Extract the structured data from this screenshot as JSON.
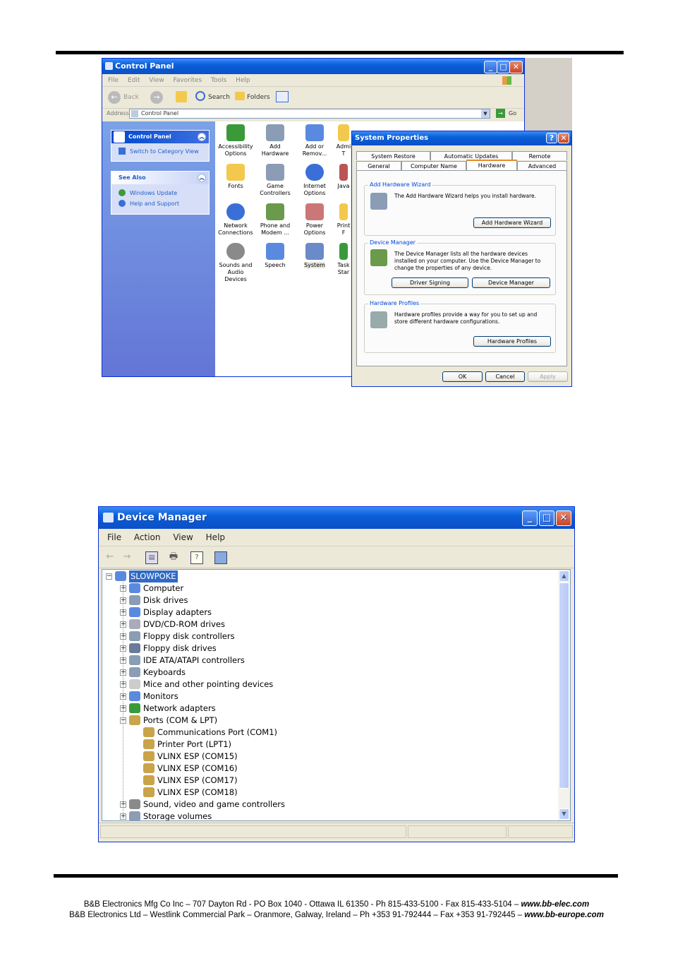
{
  "control_panel": {
    "title": "Control Panel",
    "menu": [
      "File",
      "Edit",
      "View",
      "Favorites",
      "Tools",
      "Help"
    ],
    "toolbar": {
      "back": "Back",
      "search": "Search",
      "folders": "Folders"
    },
    "address_label": "Address",
    "address_value": "Control Panel",
    "go": "Go",
    "left_panel": {
      "header": "Control Panel",
      "switch_view": "Switch to Category View",
      "see_also": "See Also",
      "links": [
        "Windows Update",
        "Help and Support"
      ]
    },
    "icons": [
      {
        "label": "Accessibility Options"
      },
      {
        "label": "Add Hardware"
      },
      {
        "label": "Add or Remov..."
      },
      {
        "label": "Admi T"
      },
      {
        "label": "Fonts"
      },
      {
        "label": "Game Controllers"
      },
      {
        "label": "Internet Options"
      },
      {
        "label": "Java"
      },
      {
        "label": "Network Connections"
      },
      {
        "label": "Phone and Modem ..."
      },
      {
        "label": "Power Options"
      },
      {
        "label": "Print F"
      },
      {
        "label": "Sounds and Audio Devices"
      },
      {
        "label": "Speech"
      },
      {
        "label": "System"
      },
      {
        "label": "Task Star"
      }
    ]
  },
  "system_properties": {
    "title": "System Properties",
    "tabs_back": [
      "System Restore",
      "Automatic Updates",
      "Remote"
    ],
    "tabs_front": [
      "General",
      "Computer Name",
      "Hardware",
      "Advanced"
    ],
    "add_hw": {
      "label": "Add Hardware Wizard",
      "text": "The Add Hardware Wizard helps you install hardware.",
      "button": "Add Hardware Wizard"
    },
    "devmgr": {
      "label": "Device Manager",
      "text": "The Device Manager lists all the hardware devices installed on your computer. Use the Device Manager to change the properties of any device.",
      "btn_signing": "Driver Signing",
      "btn_devmgr": "Device Manager"
    },
    "hwprof": {
      "label": "Hardware Profiles",
      "text": "Hardware profiles provide a way for you to set up and store different hardware configurations.",
      "button": "Hardware Profiles"
    },
    "ok": "OK",
    "cancel": "Cancel",
    "apply": "Apply"
  },
  "device_manager": {
    "title": "Device Manager",
    "menu": [
      "File",
      "Action",
      "View",
      "Help"
    ],
    "root": "SLOWPOKE",
    "categories": [
      "Computer",
      "Disk drives",
      "Display adapters",
      "DVD/CD-ROM drives",
      "Floppy disk controllers",
      "Floppy disk drives",
      "IDE ATA/ATAPI controllers",
      "Keyboards",
      "Mice and other pointing devices",
      "Monitors",
      "Network adapters",
      "Ports (COM & LPT)"
    ],
    "ports": [
      "Communications Port (COM1)",
      "Printer Port (LPT1)",
      "VLINX ESP (COM15)",
      "VLINX ESP (COM16)",
      "VLINX ESP (COM17)",
      "VLINX ESP (COM18)"
    ],
    "after": [
      "Sound, video and game controllers",
      "Storage volumes"
    ]
  },
  "footer": {
    "line1": "B&B Electronics Mfg Co Inc – 707 Dayton Rd - PO Box 1040 - Ottawa IL 61350 - Ph 815-433-5100 - Fax 815-433-5104 – ",
    "url1": "www.bb-elec.com",
    "line2": "B&B Electronics Ltd – Westlink Commercial Park – Oranmore, Galway, Ireland – Ph +353 91-792444 – Fax +353 91-792445 – ",
    "url2": "www.bb-europe.com"
  },
  "colors": {
    "xp_title": "#0a5fd8",
    "selection": "#316ac5",
    "left_pane": "#6f8fe0"
  }
}
